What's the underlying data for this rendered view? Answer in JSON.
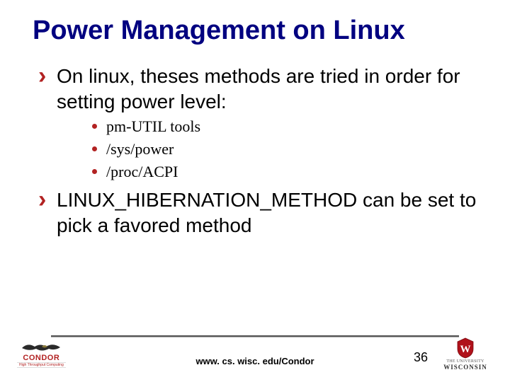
{
  "title": "Power Management on Linux",
  "bullets": [
    {
      "text": "On linux, theses methods are tried in order for setting power level:",
      "sub": [
        "pm-UTIL tools",
        "/sys/power",
        "/proc/ACPI"
      ]
    },
    {
      "text": "LINUX_HIBERNATION_METHOD can be set to pick a favored method",
      "sub": []
    }
  ],
  "footer": {
    "url": "www. cs. wisc. edu/Condor",
    "page": "36",
    "condor": "CONDOR",
    "hpc": "High Throughput Computing",
    "wisc1": "THE UNIVERSITY",
    "wisc2": "WISCONSIN"
  }
}
